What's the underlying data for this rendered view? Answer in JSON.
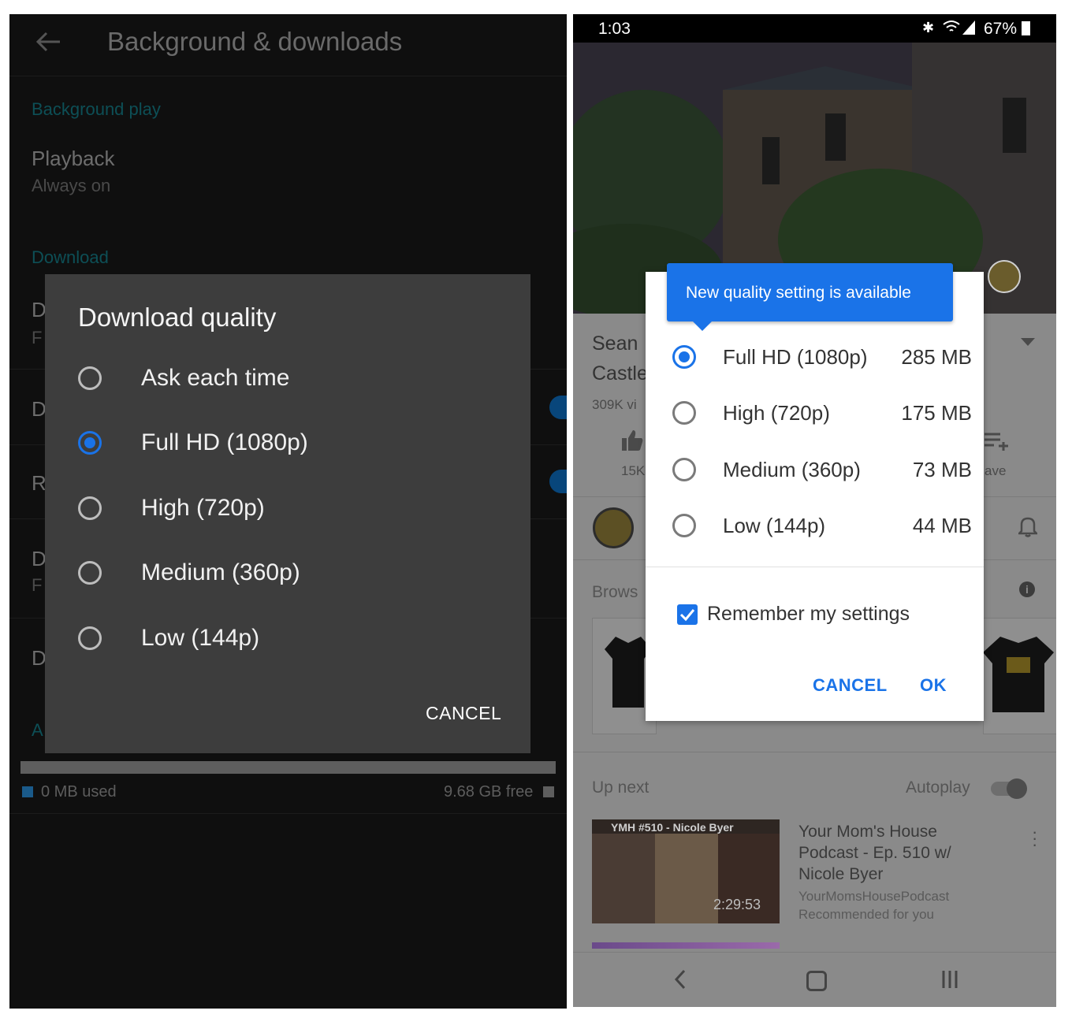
{
  "left": {
    "header": {
      "title": "Background & downloads"
    },
    "sections": {
      "background_play": "Background play",
      "download": "Download"
    },
    "playback": {
      "title": "Playback",
      "value": "Always on"
    },
    "partial_rows": [
      "D",
      "F",
      "D",
      "R",
      "D",
      "F",
      "D",
      "A"
    ],
    "storage": {
      "used": "0 MB used",
      "free": "9.68 GB free",
      "used_color": "#1a73e8"
    },
    "dialog": {
      "title": "Download quality",
      "options": [
        {
          "label": "Ask each time",
          "selected": false
        },
        {
          "label": "Full HD (1080p)",
          "selected": true
        },
        {
          "label": "High (720p)",
          "selected": false
        },
        {
          "label": "Medium (360p)",
          "selected": false
        },
        {
          "label": "Low (144p)",
          "selected": false
        }
      ],
      "cancel_label": "CANCEL"
    }
  },
  "right": {
    "status_bar": {
      "time": "1:03",
      "battery": "67%"
    },
    "video": {
      "title_partial_1": "Sean",
      "title_partial_2": "Castle",
      "views_partial": "309K vi",
      "likes_partial": "15K",
      "save_partial": "ave"
    },
    "browse_partial": "Brows",
    "up_next": {
      "label": "Up next",
      "autoplay_label": "Autoplay",
      "item": {
        "title": "Your Mom's House Podcast - Ep. 510 w/ Nicole Byer",
        "channel": "YourMomsHousePodcast",
        "reason": "Recommended for you",
        "duration": "2:29:53",
        "thumb_text": "YMH #510 - Nicole Byer"
      }
    },
    "dialog": {
      "tooltip": "New quality setting is available",
      "options": [
        {
          "label": "Full HD (1080p)",
          "size": "285 MB",
          "selected": true
        },
        {
          "label": "High (720p)",
          "size": "175 MB",
          "selected": false
        },
        {
          "label": "Medium (360p)",
          "size": "73 MB",
          "selected": false
        },
        {
          "label": "Low (144p)",
          "size": "44 MB",
          "selected": false
        }
      ],
      "remember_label": "Remember my settings",
      "remember_checked": true,
      "cancel_label": "CANCEL",
      "ok_label": "OK"
    },
    "accent_color": "#1a73e8"
  }
}
